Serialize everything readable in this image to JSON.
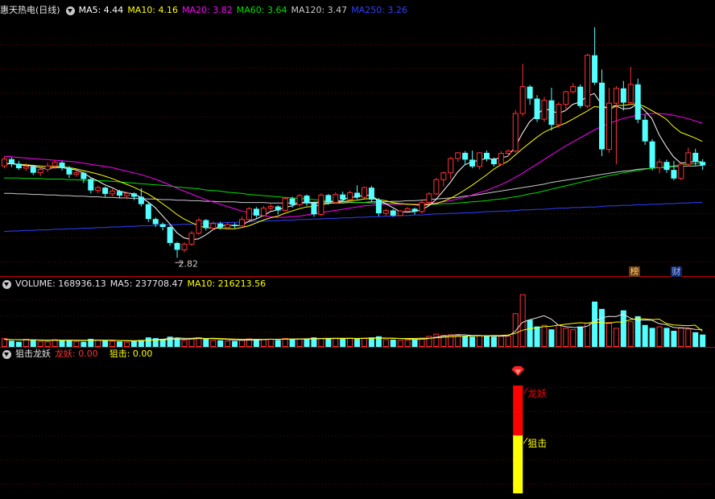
{
  "main": {
    "title": "惠天热电(日线)",
    "ma": [
      {
        "label": "MA5: 4.44",
        "color": "#ffffff"
      },
      {
        "label": "MA10: 4.16",
        "color": "#ffff00"
      },
      {
        "label": "MA20: 3.82",
        "color": "#ff00ff"
      },
      {
        "label": "MA60: 3.64",
        "color": "#00e000"
      },
      {
        "label": "MA120: 3.47",
        "color": "#c8c8c8"
      },
      {
        "label": "MA250: 3.26",
        "color": "#3040ff"
      }
    ],
    "low_label": "2.82",
    "badges": [
      "榜",
      "财"
    ]
  },
  "volume": {
    "label": "VOLUME: 168936.13",
    "ma5": "MA5: 237708.47",
    "ma10": "MA10: 216213.56"
  },
  "indicator": {
    "name": "狙击龙妖",
    "longyao_label": "龙妖: 0.00",
    "juji_label": "狙击: 0.00",
    "signal_labels": [
      "龙妖",
      "狙击"
    ]
  },
  "colors": {
    "up": "#ff3232",
    "down": "#54ffff",
    "ma5": "#ffffff",
    "ma10": "#ffff00",
    "ma20": "#ff00ff",
    "ma60": "#00e000",
    "ma120": "#c8c8c8",
    "ma250": "#3040ff",
    "signal_red": "#ff0000",
    "signal_yellow": "#ffff00"
  },
  "chart_data": {
    "type": "candlestick",
    "candles": [
      [
        4.43,
        4.55,
        4.59,
        4.39
      ],
      [
        4.55,
        4.47,
        4.58,
        4.41
      ],
      [
        4.47,
        4.39,
        4.52,
        4.36
      ],
      [
        4.39,
        4.42,
        4.48,
        4.34
      ],
      [
        4.42,
        4.31,
        4.45,
        4.27
      ],
      [
        4.31,
        4.37,
        4.4,
        4.25
      ],
      [
        4.37,
        4.43,
        4.49,
        4.32
      ],
      [
        4.43,
        4.49,
        4.54,
        4.38
      ],
      [
        4.49,
        4.4,
        4.52,
        4.35
      ],
      [
        4.4,
        4.28,
        4.43,
        4.22
      ],
      [
        4.28,
        4.31,
        4.35,
        4.24
      ],
      [
        4.31,
        4.2,
        4.33,
        4.13
      ],
      [
        4.2,
        4.0,
        4.22,
        3.95
      ],
      [
        4.0,
        4.05,
        4.08,
        3.95
      ],
      [
        4.05,
        3.94,
        4.07,
        3.89
      ],
      [
        3.94,
        3.99,
        4.03,
        3.9
      ],
      [
        3.99,
        3.91,
        4.01,
        3.86
      ],
      [
        3.91,
        3.95,
        3.98,
        3.85
      ],
      [
        3.95,
        3.89,
        3.97,
        3.83
      ],
      [
        3.89,
        3.76,
        4.04,
        3.72
      ],
      [
        3.76,
        3.5,
        3.78,
        3.45
      ],
      [
        3.5,
        3.41,
        3.53,
        3.36
      ],
      [
        3.41,
        3.36,
        3.44,
        3.3
      ],
      [
        3.36,
        3.08,
        3.38,
        3.03
      ],
      [
        3.08,
        2.96,
        3.1,
        2.82
      ],
      [
        2.96,
        3.06,
        3.09,
        2.92
      ],
      [
        3.06,
        3.25,
        3.29,
        3.03
      ],
      [
        3.25,
        3.48,
        3.52,
        3.22
      ],
      [
        3.48,
        3.34,
        3.5,
        3.3
      ],
      [
        3.34,
        3.42,
        3.46,
        3.31
      ],
      [
        3.42,
        3.35,
        3.45,
        3.31
      ],
      [
        3.35,
        3.4,
        3.44,
        3.32
      ],
      [
        3.4,
        3.38,
        3.43,
        3.34
      ],
      [
        3.38,
        3.49,
        3.54,
        3.37
      ],
      [
        3.49,
        3.68,
        3.71,
        3.47
      ],
      [
        3.68,
        3.56,
        3.71,
        3.52
      ],
      [
        3.56,
        3.69,
        3.73,
        3.54
      ],
      [
        3.69,
        3.72,
        3.76,
        3.65
      ],
      [
        3.72,
        3.65,
        3.74,
        3.58
      ],
      [
        3.65,
        3.86,
        3.88,
        3.63
      ],
      [
        3.86,
        3.75,
        3.89,
        3.7
      ],
      [
        3.75,
        3.91,
        3.94,
        3.72
      ],
      [
        3.91,
        3.78,
        3.93,
        3.73
      ],
      [
        3.78,
        3.58,
        3.81,
        3.54
      ],
      [
        3.58,
        3.92,
        3.95,
        3.56
      ],
      [
        3.92,
        3.79,
        3.94,
        3.75
      ],
      [
        3.79,
        3.93,
        3.97,
        3.77
      ],
      [
        3.93,
        3.84,
        3.98,
        3.8
      ],
      [
        3.84,
        3.96,
        4.0,
        3.82
      ],
      [
        3.96,
        3.88,
        4.09,
        3.85
      ],
      [
        3.88,
        4.05,
        4.07,
        3.86
      ],
      [
        4.05,
        3.84,
        4.08,
        3.8
      ],
      [
        3.84,
        3.6,
        3.87,
        3.55
      ],
      [
        3.6,
        3.65,
        3.68,
        3.56
      ],
      [
        3.65,
        3.56,
        3.67,
        3.54
      ],
      [
        3.56,
        3.64,
        3.66,
        3.55
      ],
      [
        3.64,
        3.68,
        3.71,
        3.62
      ],
      [
        3.68,
        3.63,
        3.7,
        3.58
      ],
      [
        3.63,
        3.79,
        3.82,
        3.6
      ],
      [
        3.79,
        3.94,
        3.97,
        3.77
      ],
      [
        3.94,
        4.19,
        4.22,
        3.92
      ],
      [
        4.19,
        4.31,
        4.33,
        4.07
      ],
      [
        4.31,
        4.56,
        4.59,
        4.2
      ],
      [
        4.56,
        4.66,
        4.67,
        4.5
      ],
      [
        4.66,
        4.54,
        4.69,
        4.45
      ],
      [
        4.54,
        4.42,
        4.7,
        4.39
      ],
      [
        4.42,
        4.66,
        4.67,
        4.37
      ],
      [
        4.66,
        4.55,
        4.7,
        4.51
      ],
      [
        4.55,
        4.46,
        4.58,
        4.42
      ],
      [
        4.46,
        4.65,
        4.69,
        4.44
      ],
      [
        4.65,
        4.69,
        4.72,
        4.6
      ],
      [
        4.69,
        5.35,
        5.41,
        4.66
      ],
      [
        5.35,
        5.82,
        6.22,
        5.3
      ],
      [
        5.82,
        5.61,
        5.85,
        5.5
      ],
      [
        5.61,
        5.25,
        5.67,
        5.2
      ],
      [
        5.25,
        5.58,
        5.64,
        5.2
      ],
      [
        5.58,
        5.15,
        5.8,
        5.05
      ],
      [
        5.15,
        5.51,
        5.55,
        5.1
      ],
      [
        5.51,
        5.73,
        5.75,
        5.4
      ],
      [
        5.73,
        5.82,
        5.88,
        5.7
      ],
      [
        5.82,
        5.48,
        5.86,
        5.44
      ],
      [
        5.48,
        6.37,
        6.4,
        5.44
      ],
      [
        6.37,
        5.89,
        6.86,
        5.85
      ],
      [
        5.89,
        4.72,
        6.12,
        4.6
      ],
      [
        4.72,
        5.53,
        5.8,
        4.66
      ],
      [
        5.53,
        5.79,
        5.83,
        4.46
      ],
      [
        5.79,
        5.54,
        5.92,
        5.4
      ],
      [
        5.54,
        5.86,
        6.17,
        5.5
      ],
      [
        5.86,
        5.24,
        5.96,
        5.18
      ],
      [
        5.24,
        4.86,
        5.33,
        4.8
      ],
      [
        4.86,
        4.4,
        4.9,
        4.35
      ],
      [
        4.4,
        4.5,
        4.55,
        4.3
      ],
      [
        4.5,
        4.36,
        4.54,
        4.31
      ],
      [
        4.36,
        4.21,
        4.52,
        4.18
      ],
      [
        4.21,
        4.46,
        4.5,
        4.18
      ],
      [
        4.46,
        4.66,
        4.75,
        4.42
      ],
      [
        4.66,
        4.5,
        4.73,
        4.44
      ],
      [
        4.5,
        4.44,
        4.55,
        4.36
      ]
    ],
    "ma5": [
      4.46,
      4.47,
      4.45,
      4.44,
      4.43,
      4.4,
      4.38,
      4.4,
      4.4,
      4.38,
      4.36,
      4.31,
      4.23,
      4.17,
      4.1,
      4.05,
      3.99,
      3.96,
      3.94,
      3.88,
      3.8,
      3.7,
      3.56,
      3.42,
      3.26,
      3.17,
      3.14,
      3.15,
      3.22,
      3.31,
      3.37,
      3.4,
      3.38,
      3.39,
      3.46,
      3.5,
      3.56,
      3.63,
      3.66,
      3.7,
      3.73,
      3.78,
      3.8,
      3.79,
      3.8,
      3.8,
      3.81,
      3.82,
      3.89,
      3.88,
      3.92,
      3.91,
      3.83,
      3.77,
      3.7,
      3.63,
      3.62,
      3.63,
      3.66,
      3.73,
      3.84,
      3.99,
      4.14,
      4.32,
      4.45,
      4.5,
      4.53,
      4.56,
      4.55,
      4.57,
      4.6,
      4.76,
      5.0,
      5.2,
      5.32,
      5.44,
      5.4,
      5.35,
      5.4,
      5.51,
      5.55,
      5.65,
      5.7,
      5.51,
      5.41,
      5.48,
      5.43,
      5.44,
      5.52,
      5.4,
      5.26,
      4.98,
      4.77,
      4.59,
      4.48,
      4.49,
      4.51,
      4.5
    ],
    "ma10": [
      4.47,
      4.47,
      4.46,
      4.45,
      4.44,
      4.43,
      4.42,
      4.42,
      4.42,
      4.4,
      4.38,
      4.35,
      4.32,
      4.29,
      4.25,
      4.21,
      4.16,
      4.11,
      4.06,
      4.0,
      3.94,
      3.86,
      3.77,
      3.68,
      3.58,
      3.5,
      3.44,
      3.38,
      3.35,
      3.34,
      3.34,
      3.33,
      3.33,
      3.35,
      3.38,
      3.43,
      3.48,
      3.52,
      3.55,
      3.6,
      3.64,
      3.68,
      3.71,
      3.72,
      3.75,
      3.77,
      3.79,
      3.8,
      3.82,
      3.83,
      3.85,
      3.86,
      3.84,
      3.82,
      3.79,
      3.77,
      3.76,
      3.75,
      3.74,
      3.75,
      3.77,
      3.81,
      3.86,
      3.93,
      4.01,
      4.09,
      4.18,
      4.27,
      4.37,
      4.45,
      4.51,
      4.62,
      4.73,
      4.83,
      4.93,
      5.02,
      5.08,
      5.13,
      5.18,
      5.25,
      5.32,
      5.39,
      5.47,
      5.46,
      5.46,
      5.49,
      5.49,
      5.51,
      5.52,
      5.47,
      5.4,
      5.33,
      5.25,
      5.12,
      5.02,
      4.97,
      4.92,
      4.86
    ],
    "ma20": [
      4.6,
      4.59,
      4.58,
      4.57,
      4.56,
      4.55,
      4.54,
      4.53,
      4.52,
      4.51,
      4.5,
      4.48,
      4.46,
      4.44,
      4.42,
      4.4,
      4.37,
      4.34,
      4.31,
      4.28,
      4.24,
      4.2,
      4.15,
      4.1,
      4.04,
      3.99,
      3.94,
      3.89,
      3.84,
      3.8,
      3.76,
      3.72,
      3.68,
      3.64,
      3.61,
      3.58,
      3.56,
      3.54,
      3.53,
      3.53,
      3.54,
      3.55,
      3.57,
      3.59,
      3.61,
      3.63,
      3.65,
      3.67,
      3.69,
      3.71,
      3.73,
      3.74,
      3.75,
      3.76,
      3.76,
      3.76,
      3.76,
      3.76,
      3.76,
      3.77,
      3.78,
      3.8,
      3.82,
      3.85,
      3.88,
      3.92,
      3.96,
      4.0,
      4.05,
      4.1,
      4.16,
      4.23,
      4.3,
      4.38,
      4.46,
      4.54,
      4.62,
      4.7,
      4.78,
      4.85,
      4.92,
      4.99,
      5.06,
      5.12,
      5.17,
      5.22,
      5.26,
      5.29,
      5.32,
      5.34,
      5.35,
      5.35,
      5.34,
      5.32,
      5.29,
      5.26,
      5.22,
      5.18
    ],
    "ma60": [
      4.22,
      4.22,
      4.22,
      4.21,
      4.21,
      4.21,
      4.2,
      4.2,
      4.2,
      4.19,
      4.19,
      4.18,
      4.18,
      4.17,
      4.17,
      4.16,
      4.15,
      4.14,
      4.13,
      4.12,
      4.11,
      4.1,
      4.09,
      4.08,
      4.06,
      4.05,
      4.04,
      4.03,
      4.01,
      4.0,
      3.99,
      3.97,
      3.96,
      3.95,
      3.93,
      3.92,
      3.91,
      3.9,
      3.89,
      3.88,
      3.87,
      3.86,
      3.85,
      3.84,
      3.83,
      3.82,
      3.81,
      3.8,
      3.8,
      3.79,
      3.79,
      3.78,
      3.78,
      3.77,
      3.77,
      3.77,
      3.76,
      3.76,
      3.76,
      3.76,
      3.76,
      3.77,
      3.77,
      3.78,
      3.79,
      3.8,
      3.81,
      3.82,
      3.84,
      3.85,
      3.87,
      3.89,
      3.91,
      3.94,
      3.96,
      3.99,
      4.02,
      4.05,
      4.08,
      4.11,
      4.14,
      4.17,
      4.2,
      4.23,
      4.26,
      4.28,
      4.31,
      4.33,
      4.35,
      4.37,
      4.39,
      4.4,
      4.42,
      4.43,
      4.45,
      4.46,
      4.47,
      4.48
    ],
    "ma120": [
      3.95,
      3.95,
      3.94,
      3.94,
      3.93,
      3.93,
      3.92,
      3.92,
      3.91,
      3.91,
      3.9,
      3.9,
      3.89,
      3.89,
      3.88,
      3.88,
      3.87,
      3.87,
      3.86,
      3.86,
      3.85,
      3.85,
      3.84,
      3.84,
      3.83,
      3.83,
      3.82,
      3.82,
      3.81,
      3.81,
      3.8,
      3.8,
      3.8,
      3.79,
      3.79,
      3.79,
      3.79,
      3.78,
      3.78,
      3.78,
      3.78,
      3.78,
      3.78,
      3.78,
      3.78,
      3.78,
      3.78,
      3.78,
      3.79,
      3.79,
      3.79,
      3.8,
      3.8,
      3.8,
      3.81,
      3.81,
      3.82,
      3.82,
      3.83,
      3.84,
      3.85,
      3.86,
      3.87,
      3.88,
      3.9,
      3.91,
      3.93,
      3.95,
      3.97,
      3.99,
      4.01,
      4.03,
      4.05,
      4.07,
      4.09,
      4.11,
      4.14,
      4.16,
      4.18,
      4.2,
      4.22,
      4.24,
      4.26,
      4.28,
      4.3,
      4.32,
      4.34,
      4.35,
      4.37,
      4.38,
      4.39,
      4.4,
      4.41,
      4.42,
      4.42,
      4.43,
      4.43,
      4.44
    ],
    "ma250": [
      3.28,
      3.29,
      3.29,
      3.3,
      3.3,
      3.31,
      3.31,
      3.32,
      3.32,
      3.33,
      3.33,
      3.34,
      3.34,
      3.35,
      3.35,
      3.36,
      3.36,
      3.37,
      3.37,
      3.38,
      3.38,
      3.39,
      3.39,
      3.4,
      3.4,
      3.41,
      3.41,
      3.42,
      3.42,
      3.43,
      3.43,
      3.44,
      3.44,
      3.45,
      3.45,
      3.46,
      3.46,
      3.47,
      3.47,
      3.48,
      3.48,
      3.49,
      3.49,
      3.5,
      3.5,
      3.51,
      3.51,
      3.52,
      3.52,
      3.53,
      3.53,
      3.54,
      3.54,
      3.55,
      3.55,
      3.56,
      3.56,
      3.57,
      3.57,
      3.58,
      3.59,
      3.59,
      3.6,
      3.6,
      3.61,
      3.61,
      3.62,
      3.63,
      3.63,
      3.64,
      3.64,
      3.65,
      3.66,
      3.66,
      3.67,
      3.67,
      3.68,
      3.69,
      3.69,
      3.7,
      3.7,
      3.71,
      3.71,
      3.72,
      3.73,
      3.73,
      3.74,
      3.74,
      3.75,
      3.75,
      3.76,
      3.76,
      3.77,
      3.77,
      3.78,
      3.78,
      3.79,
      3.79
    ],
    "volume": [
      120000,
      85000,
      70000,
      110000,
      95000,
      80000,
      75000,
      105000,
      90000,
      95000,
      80000,
      70000,
      110000,
      100000,
      90000,
      85000,
      75000,
      70000,
      80000,
      95000,
      130000,
      120000,
      110000,
      140000,
      125000,
      95000,
      115000,
      130000,
      110000,
      95000,
      90000,
      85000,
      80000,
      95000,
      115000,
      100000,
      105000,
      110000,
      95000,
      120000,
      105000,
      115000,
      110000,
      130000,
      120000,
      110000,
      120000,
      115000,
      125000,
      110000,
      120000,
      130000,
      145000,
      105000,
      100000,
      95000,
      100000,
      105000,
      125000,
      150000,
      180000,
      165000,
      170000,
      160000,
      150000,
      140000,
      160000,
      150000,
      140000,
      150000,
      155000,
      460000,
      720000,
      370000,
      280000,
      300000,
      240000,
      300000,
      260000,
      240000,
      280000,
      330000,
      620000,
      520000,
      340000,
      260000,
      500000,
      350000,
      420000,
      300000,
      260000,
      280000,
      260000,
      220000,
      270000,
      250000,
      200000,
      168936
    ],
    "vol_ma5": [
      105000,
      100000,
      96000,
      96000,
      96000,
      92000,
      87000,
      93000,
      89000,
      89000,
      89000,
      86000,
      90000,
      91000,
      90000,
      91000,
      87000,
      84000,
      80000,
      81000,
      90000,
      99000,
      105000,
      115000,
      125000,
      118000,
      117000,
      124000,
      115000,
      113000,
      108000,
      104000,
      92000,
      91000,
      93000,
      94000,
      99000,
      105000,
      105000,
      106000,
      107000,
      109000,
      111000,
      114000,
      116000,
      117000,
      118000,
      119000,
      118000,
      116000,
      118000,
      120000,
      124000,
      121000,
      120000,
      115000,
      109000,
      101000,
      105000,
      115000,
      132000,
      146000,
      158000,
      167000,
      165000,
      157000,
      156000,
      152000,
      148000,
      148000,
      149000,
      211000,
      335000,
      371000,
      397000,
      426000,
      382000,
      298000,
      276000,
      268000,
      264000,
      282000,
      346000,
      398000,
      418000,
      414000,
      448000,
      394000,
      366000,
      366000,
      366000,
      318000,
      304000,
      268000,
      258000,
      256000,
      240000,
      237708
    ],
    "vol_ma10": [
      102000,
      100000,
      98000,
      98000,
      97000,
      95000,
      93000,
      94000,
      93000,
      92000,
      92000,
      90000,
      92000,
      92000,
      91000,
      90000,
      88000,
      87000,
      86000,
      87000,
      90000,
      94000,
      97000,
      102000,
      107000,
      105000,
      108000,
      114000,
      115000,
      119000,
      114000,
      110000,
      108000,
      103000,
      103000,
      104000,
      104000,
      106000,
      103000,
      106000,
      107000,
      106000,
      107000,
      108000,
      112000,
      112000,
      114000,
      115000,
      116000,
      116000,
      117000,
      118000,
      120000,
      119000,
      117000,
      116000,
      116000,
      116000,
      118000,
      118000,
      125000,
      132000,
      137000,
      144000,
      148000,
      151000,
      152000,
      153000,
      155000,
      158000,
      162000,
      184000,
      228000,
      248000,
      263000,
      276000,
      282000,
      297000,
      309000,
      321000,
      330000,
      325000,
      340000,
      334000,
      322000,
      340000,
      340000,
      372000,
      386000,
      382000,
      373000,
      380000,
      320000,
      301000,
      295000,
      290000,
      297000,
      216213
    ],
    "signal": {
      "index": 71,
      "longyao": [
        0,
        1
      ],
      "juji": [
        1,
        0
      ]
    }
  }
}
